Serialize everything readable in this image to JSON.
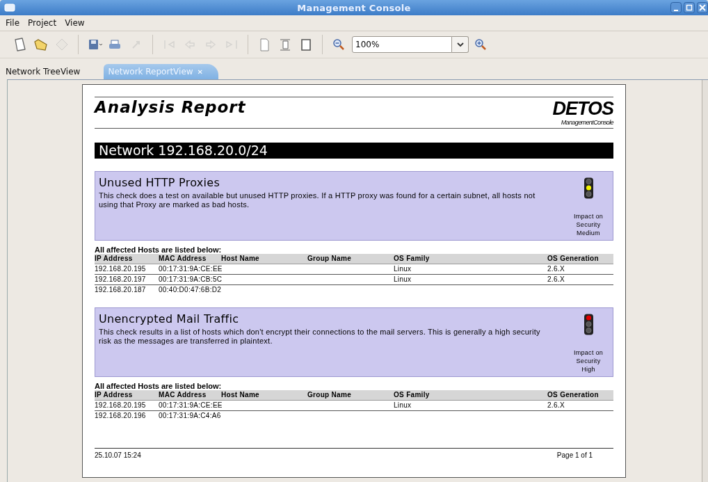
{
  "window": {
    "title": "Management Console"
  },
  "menu": [
    "File",
    "Project",
    "View"
  ],
  "toolbar": [
    {
      "kind": "new",
      "disabled": false
    },
    {
      "kind": "open",
      "disabled": false
    },
    {
      "kind": "erase",
      "disabled": true
    },
    {
      "kind": "sep"
    },
    {
      "kind": "save",
      "disabled": false
    },
    {
      "kind": "print",
      "disabled": false
    },
    {
      "kind": "export",
      "disabled": true
    },
    {
      "kind": "sep"
    },
    {
      "kind": "first",
      "disabled": true
    },
    {
      "kind": "back",
      "disabled": true
    },
    {
      "kind": "forward",
      "disabled": true
    },
    {
      "kind": "last",
      "disabled": true
    },
    {
      "kind": "sep"
    },
    {
      "kind": "page",
      "disabled": false
    },
    {
      "kind": "page-width",
      "disabled": false
    },
    {
      "kind": "page-fit",
      "disabled": false
    },
    {
      "kind": "sep"
    },
    {
      "kind": "zoom-out",
      "disabled": false
    }
  ],
  "zoom": {
    "value": "100%"
  },
  "tabs": [
    {
      "label": "Network TreeView",
      "selected": false
    },
    {
      "label": "Network ReportView",
      "selected": true,
      "close": "✕"
    }
  ],
  "report": {
    "title": "Analysis Report",
    "logo": "DETOS",
    "logo_subtitle": "ManagementConsole",
    "network": "Network 192.168.20.0/24",
    "checks": [
      {
        "title": "Unused HTTP Proxies",
        "description": "This check does a test on available but unused HTTP proxies. If a HTTP proxy was found for a certain subnet, all hosts not using that Proxy are marked as bad hosts.",
        "impact_label": "Impact on Security",
        "impact": "Medium",
        "color": "#f2f200",
        "hosts_caption": "All affected Hosts are listed below:",
        "columns": [
          "IP Address",
          "MAC Address",
          "Host Name",
          "Group Name",
          "OS Family",
          "OS Generation"
        ],
        "rows": [
          {
            "ip": "192.168.20.195",
            "mac": "00:17:31:9A:CE:EE",
            "os_family": "Linux",
            "os_generation": "2.6.X"
          },
          {
            "ip": "192.168.20.197",
            "mac": "00:17:31:9A:CB:5C",
            "os_family": "Linux",
            "os_generation": "2.6.X"
          },
          {
            "ip": "192.168.20.187",
            "mac": "00:40:D0:47:6B:D2"
          }
        ]
      },
      {
        "title": "Unencrypted Mail Traffic",
        "description": "This check results in a list of hosts which don't encrypt their connections to the mail servers. This is generally a high security risk as the messages are transferred in plaintext.",
        "impact_label": "Impact on Security",
        "impact": "High",
        "color": "#e00000",
        "hosts_caption": "All affected Hosts are listed below:",
        "columns": [
          "IP Address",
          "MAC Address",
          "Host Name",
          "Group Name",
          "OS Family",
          "OS Generation"
        ],
        "rows": [
          {
            "ip": "192.168.20.195",
            "mac": "00:17:31:9A:CE:EE",
            "os_family": "Linux",
            "os_generation": "2.6.X"
          },
          {
            "ip": "192.168.20.196",
            "mac": "00:17:31:9A:C4:A6"
          }
        ]
      }
    ],
    "footer_date": "25.10.07 15:24",
    "footer_page": "Page 1 of 1"
  }
}
